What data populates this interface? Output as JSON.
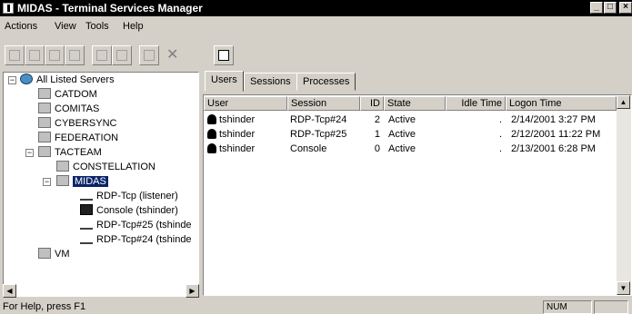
{
  "window": {
    "title": "MIDAS - Terminal Services Manager"
  },
  "menu": {
    "actions": "Actions",
    "view": "View",
    "tools": "Tools",
    "help": "Help"
  },
  "tree": {
    "root": "All Listed Servers",
    "servers": [
      "CATDOM",
      "COMITAS",
      "CYBERSYNC",
      "FEDERATION"
    ],
    "group": "TACTEAM",
    "constellation": "CONSTELLATION",
    "midas": "MIDAS",
    "sessions": [
      "RDP-Tcp (listener)",
      "Console (tshinder)",
      "RDP-Tcp#25 (tshinde",
      "RDP-Tcp#24 (tshinde"
    ],
    "vm": "VM"
  },
  "tabs": [
    "Users",
    "Sessions",
    "Processes"
  ],
  "columns": [
    "User",
    "Session",
    "ID",
    "State",
    "Idle Time",
    "Logon Time"
  ],
  "rows": [
    {
      "user": "tshinder",
      "session": "RDP-Tcp#24",
      "id": "2",
      "state": "Active",
      "idle": ".",
      "logon": "2/14/2001 3:27 PM"
    },
    {
      "user": "tshinder",
      "session": "RDP-Tcp#25",
      "id": "1",
      "state": "Active",
      "idle": ".",
      "logon": "2/12/2001 11:22 PM"
    },
    {
      "user": "tshinder",
      "session": "Console",
      "id": "0",
      "state": "Active",
      "idle": ".",
      "logon": "2/13/2001 6:28 PM"
    }
  ],
  "status": {
    "text": "For Help, press F1",
    "num": "NUM"
  },
  "icons": {
    "app": "terminal-services-icon",
    "globe": "globe-server-icon",
    "server": "server-icon",
    "user": "user-icon"
  }
}
